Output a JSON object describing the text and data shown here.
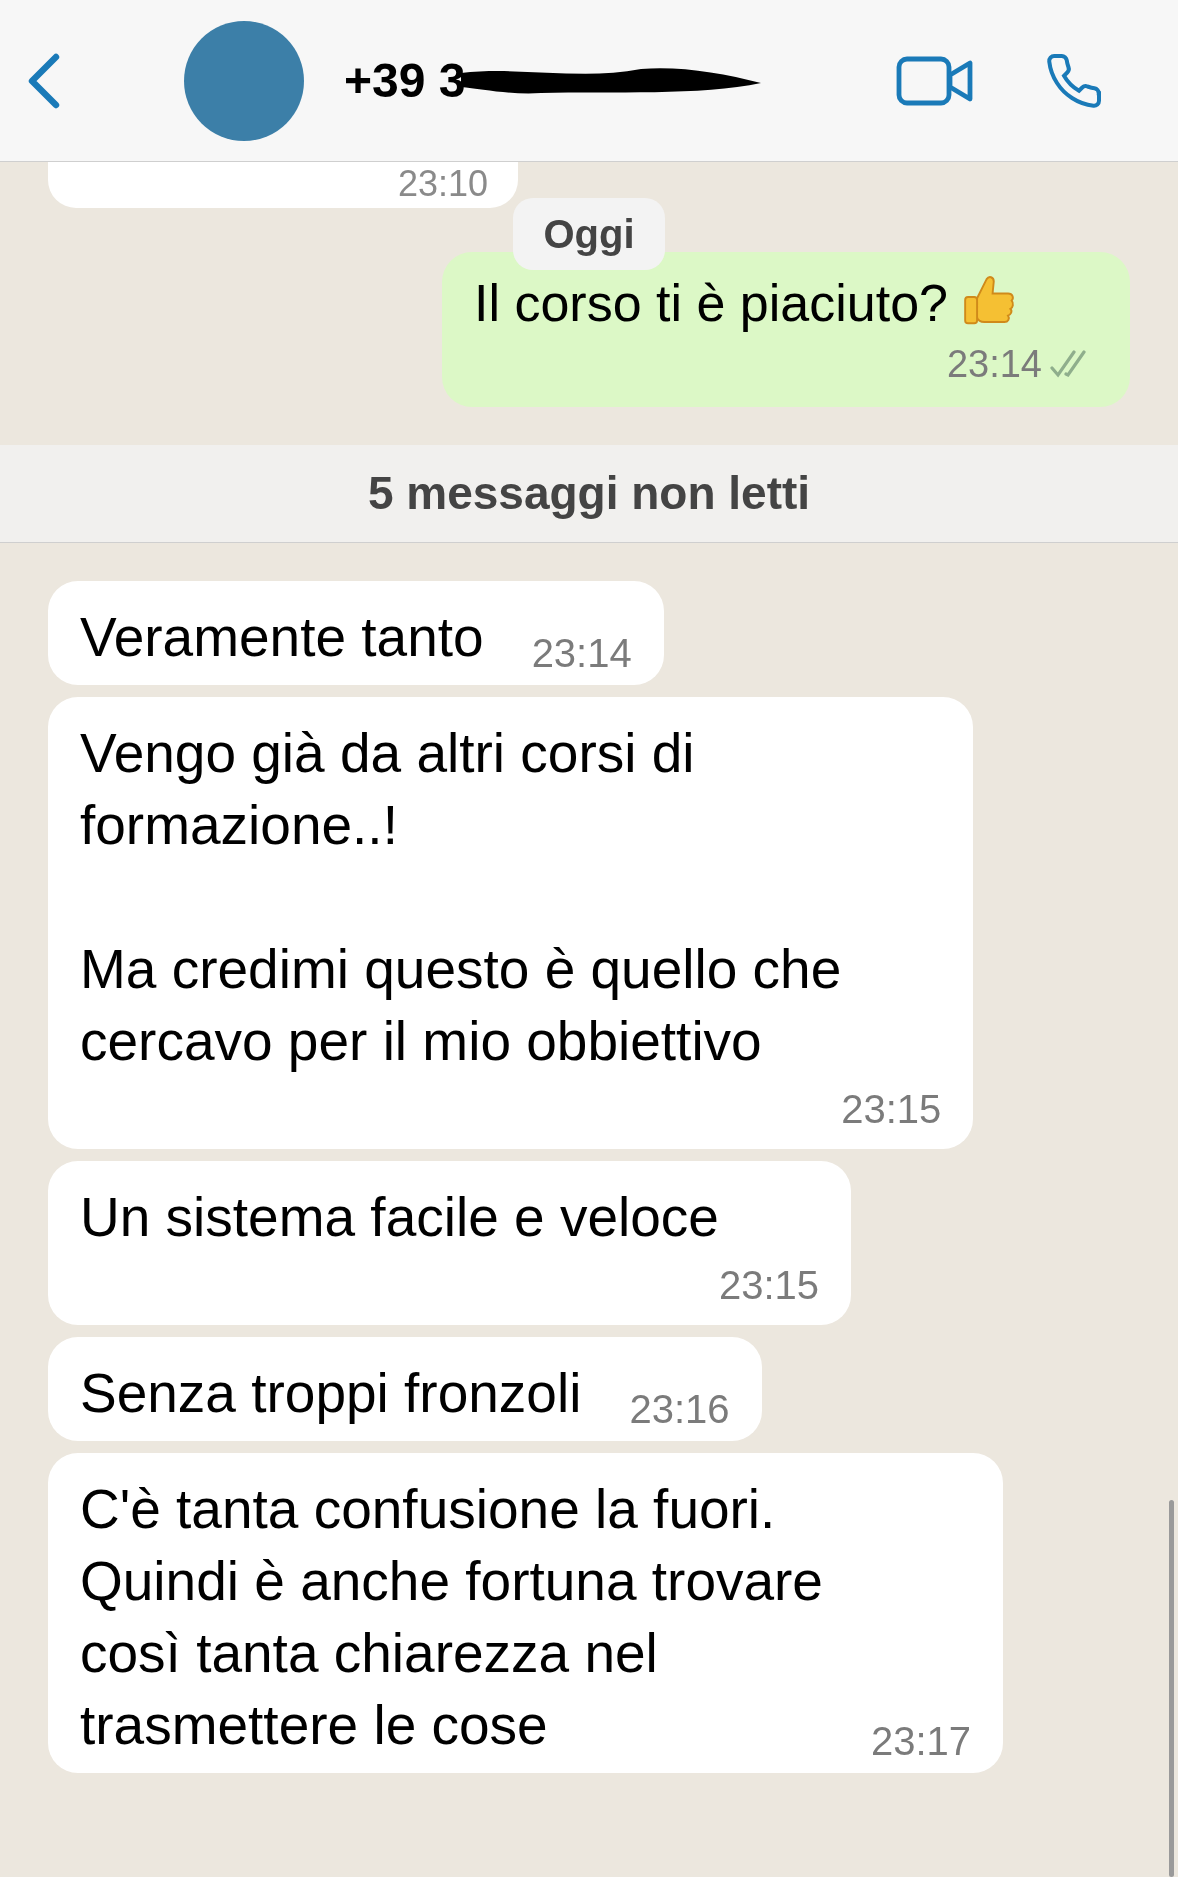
{
  "header": {
    "contact": "+39 3"
  },
  "earlier_message": {
    "time": "23:10"
  },
  "date_pill": "Oggi",
  "messages": [
    {
      "kind": "sent",
      "text": "Il corso ti è piaciuto?",
      "time": "23:14",
      "read": true
    },
    {
      "kind": "unread_divider",
      "text": "5 messaggi non letti"
    },
    {
      "kind": "received",
      "text": "Veramente tanto",
      "time": "23:14",
      "time_below": false
    },
    {
      "kind": "received",
      "text": "Vengo già da altri corsi di\nformazione..!\n\nMa credimi questo è quello che\ncercavo per il mio obbiettivo",
      "time": "23:15",
      "time_below": true
    },
    {
      "kind": "received",
      "text": "Un sistema facile e veloce",
      "time": "23:15",
      "time_below": true
    },
    {
      "kind": "received",
      "text": "Senza troppi fronzoli",
      "time": "23:16",
      "time_below": false
    },
    {
      "kind": "received",
      "text": "C'è tanta confusione la fuori.\nQuindi è anche fortuna trovare\ncosì tanta chiarezza nel\ntrasmettere le cose",
      "time": "23:17",
      "time_below": false
    }
  ]
}
